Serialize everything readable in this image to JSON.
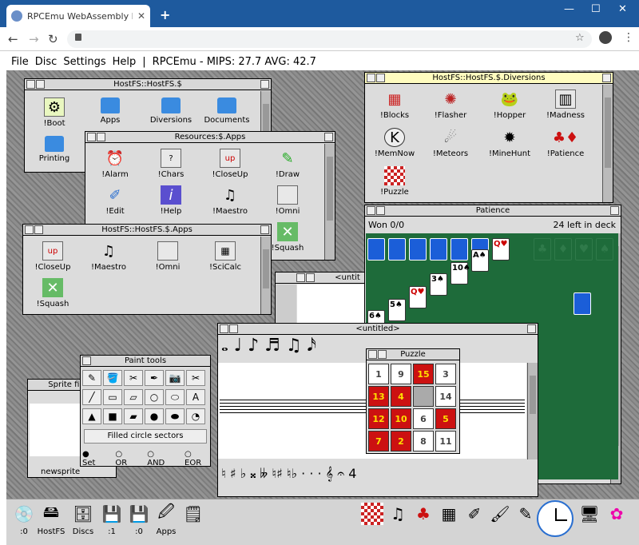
{
  "browser": {
    "tab_title": "RPCEmu WebAssembly Risc PC E",
    "tab_close": "✕",
    "new_tab": "+",
    "min": "—",
    "max": "☐",
    "close": "✕",
    "back": "←",
    "forward": "→",
    "reload": "↻",
    "star": "☆",
    "menu": "⋮"
  },
  "emu_menu": {
    "file": "File",
    "disc": "Disc",
    "settings": "Settings",
    "help": "Help",
    "sep": "|",
    "status": "RPCEmu - MIPS: 27.7 AVG: 42.7"
  },
  "hostfs": {
    "title": "HostFS::HostFS.$",
    "items": [
      "!Boot",
      "Apps",
      "Diversions",
      "Documents",
      "Printing"
    ]
  },
  "diversions": {
    "title": "HostFS::HostFS.$.Diversions",
    "items": [
      "!Blocks",
      "!Flasher",
      "!Hopper",
      "!Madness",
      "!MemNow",
      "!Meteors",
      "!MineHunt",
      "!Patience",
      "!Puzzle"
    ]
  },
  "resources": {
    "title": "Resources:$.Apps",
    "items": [
      "!Alarm",
      "!Chars",
      "!CloseUp",
      "!Draw",
      "!Edit",
      "!Help",
      "!Maestro",
      "!Omni",
      "!Squash"
    ]
  },
  "apps": {
    "title": "HostFS::HostFS.$.Apps",
    "items": [
      "!CloseUp",
      "!Maestro",
      "!Omni",
      "!SciCalc",
      "!Squash"
    ]
  },
  "patience": {
    "title": "Patience",
    "won": "Won 0/0",
    "left": "24 left in deck",
    "cards": [
      "Q",
      "10",
      "3",
      "A",
      "Q",
      "5",
      "6"
    ],
    "suits": [
      "♥",
      "♠",
      "♠",
      "♠",
      "♥",
      "♠",
      "♠"
    ]
  },
  "maestro": {
    "title": "<untitled>"
  },
  "untitled_small": {
    "title": "<untit"
  },
  "puzzle": {
    "title": "Puzzle",
    "tiles": [
      "1",
      "9",
      "15",
      "3",
      "13",
      "4",
      "",
      "14",
      "12",
      "10",
      "6",
      "5",
      "7",
      "2",
      "8",
      "11"
    ],
    "colors": [
      "white",
      "white",
      "red",
      "white",
      "red",
      "red",
      "gap",
      "white",
      "red",
      "red",
      "white",
      "red",
      "red",
      "red",
      "white",
      "white"
    ]
  },
  "paint": {
    "title": "Paint tools",
    "mode": "Filled circle sectors",
    "ops": [
      "Set",
      "OR",
      "AND",
      "EOR"
    ]
  },
  "sprite": {
    "title": "Sprite file w",
    "file": "newsprite"
  },
  "iconbar": {
    "left": [
      ":0",
      "HostFS",
      "Discs",
      ":1",
      ":0",
      "Apps"
    ]
  }
}
